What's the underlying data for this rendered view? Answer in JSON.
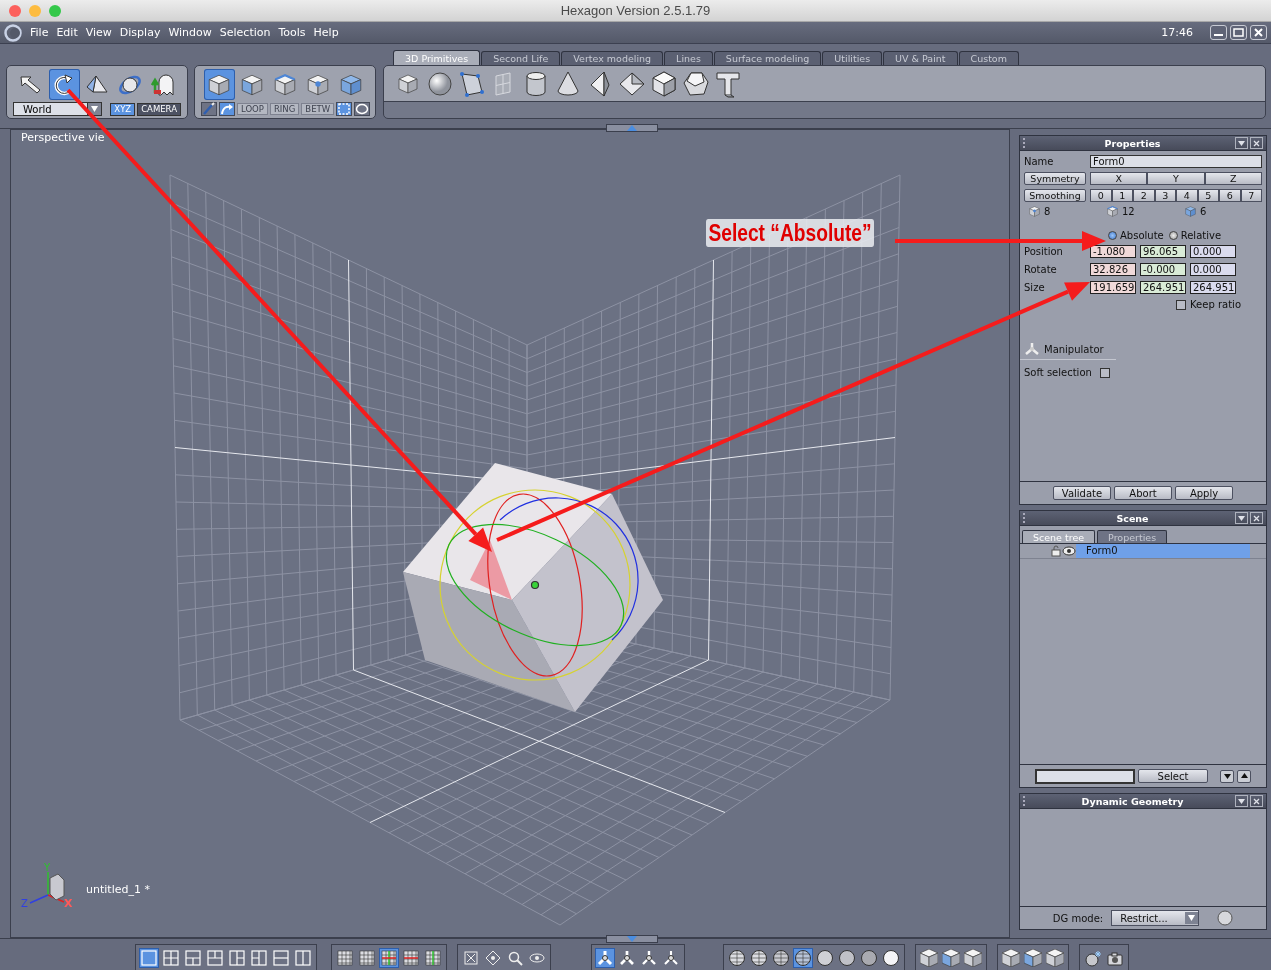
{
  "window": {
    "title": "Hexagon Version 2.5.1.79"
  },
  "menu": [
    "File",
    "Edit",
    "View",
    "Display",
    "Window",
    "Selection",
    "Tools",
    "Help"
  ],
  "clock": "17:46",
  "tool_group": {
    "tools": [
      {
        "kind": "pointer",
        "selected": false
      },
      {
        "kind": "rotate",
        "selected": true
      },
      {
        "kind": "cone",
        "selected": false
      },
      {
        "kind": "orbit",
        "selected": false
      },
      {
        "kind": "ghost",
        "selected": false
      }
    ],
    "space": "World",
    "modes": [
      {
        "label": "XYZ",
        "selected": true
      },
      {
        "label": "CAMERA",
        "selected": false
      }
    ]
  },
  "selection_group": {
    "modes": [
      {
        "kind": "object",
        "selected": true
      },
      {
        "kind": "face",
        "selected": false
      },
      {
        "kind": "edge",
        "selected": false
      },
      {
        "kind": "vertex",
        "selected": false
      },
      {
        "kind": "auto",
        "selected": false
      }
    ],
    "paint_modes": [
      {
        "kind": "brush",
        "selected": false
      },
      {
        "kind": "sweep",
        "selected": true
      }
    ],
    "loop_buttons": [
      {
        "label": "LOOP",
        "disabled": true
      },
      {
        "label": "RING",
        "disabled": true
      },
      {
        "label": "BETW",
        "disabled": true
      }
    ],
    "marquee_modes": [
      {
        "kind": "rectangle",
        "selected": true
      },
      {
        "kind": "lasso",
        "selected": false
      }
    ]
  },
  "tabs": [
    {
      "label": "3D Primitives",
      "selected": true
    },
    {
      "label": "Second Life",
      "selected": false
    },
    {
      "label": "Vertex modeling",
      "selected": false
    },
    {
      "label": "Lines",
      "selected": false
    },
    {
      "label": "Surface modeling",
      "selected": false
    },
    {
      "label": "Utilities",
      "selected": false
    },
    {
      "label": "UV & Paint",
      "selected": false
    },
    {
      "label": "Custom",
      "selected": false
    }
  ],
  "primitives": [
    {
      "kind": "cube"
    },
    {
      "kind": "sphere"
    },
    {
      "kind": "polygon"
    },
    {
      "kind": "plane"
    },
    {
      "kind": "cylinder"
    },
    {
      "kind": "cone"
    },
    {
      "kind": "pyramid"
    },
    {
      "kind": "diamond"
    },
    {
      "kind": "polyhedron"
    },
    {
      "kind": "dodecahedron"
    },
    {
      "kind": "text"
    }
  ],
  "viewport": {
    "label": "Perspective vie",
    "document": "untitled_1 *",
    "axes": [
      "Y",
      "Z",
      "X"
    ]
  },
  "annotation": {
    "text": "Select “Absolute”"
  },
  "properties": {
    "title": "Properties",
    "name_label": "Name",
    "name_value": "Form0",
    "symmetry": {
      "label": "Symmetry",
      "axes": [
        "X",
        "Y",
        "Z"
      ]
    },
    "smoothing": {
      "label": "Smoothing",
      "levels": [
        "0",
        "1",
        "2",
        "3",
        "4",
        "5",
        "6",
        "7"
      ]
    },
    "counts": [
      {
        "kind": "vertex",
        "value": "8"
      },
      {
        "kind": "edge",
        "value": "12"
      },
      {
        "kind": "face",
        "value": "6"
      }
    ],
    "coordinate_modes": [
      {
        "label": "Absolute",
        "selected": true
      },
      {
        "label": "Relative",
        "selected": false
      }
    ],
    "transforms": [
      {
        "label": "Position",
        "values": [
          "-1.080",
          "96.065",
          "0.000"
        ]
      },
      {
        "label": "Rotate",
        "values": [
          "32.826",
          "-0.000",
          "0.000"
        ]
      },
      {
        "label": "Size",
        "values": [
          "191.659",
          "264.951",
          "264.951"
        ]
      }
    ],
    "keep_ratio": {
      "label": "Keep ratio",
      "checked": false
    },
    "manipulator": "Manipulator",
    "soft_selection": {
      "label": "Soft selection",
      "checked": false
    },
    "buttons": [
      "Validate",
      "Abort",
      "Apply"
    ]
  },
  "scene": {
    "title": "Scene",
    "tabs": [
      {
        "label": "Scene tree",
        "selected": true
      },
      {
        "label": "Properties",
        "selected": false
      }
    ],
    "tree": [
      {
        "label": "Form0",
        "selected": true
      }
    ],
    "select_button": "Select"
  },
  "dynamic_geometry": {
    "title": "Dynamic Geometry",
    "mode_label": "DG mode:",
    "mode_value": "Restrict..."
  },
  "bottom_toolbar": [
    {
      "kind": "layout",
      "items": [
        {
          "selected": true
        },
        {
          "selected": false
        },
        {
          "selected": false
        },
        {
          "selected": false
        },
        {
          "selected": false
        },
        {
          "selected": false
        },
        {
          "selected": false
        },
        {
          "selected": false
        }
      ]
    },
    {
      "kind": "grid",
      "items": [
        {
          "selected": false
        },
        {
          "selected": false
        },
        {
          "selected": true
        },
        {
          "selected": false
        },
        {
          "selected": false
        }
      ]
    },
    {
      "kind": "navigation",
      "items": [
        {
          "selected": false
        },
        {
          "selected": false
        },
        {
          "selected": false
        },
        {
          "selected": false
        }
      ]
    },
    {
      "kind": "manipulator",
      "items": [
        {
          "selected": true
        },
        {
          "selected": false
        },
        {
          "selected": false
        },
        {
          "selected": false
        }
      ]
    },
    {
      "kind": "shading",
      "items": [
        {
          "selected": false
        },
        {
          "selected": false
        },
        {
          "selected": false
        },
        {
          "selected": true
        },
        {
          "selected": false
        },
        {
          "selected": false
        },
        {
          "selected": false
        },
        {
          "selected": false
        }
      ]
    },
    {
      "kind": "shape",
      "items": [
        {
          "selected": false
        },
        {
          "selected": false
        },
        {
          "selected": false
        }
      ]
    },
    {
      "kind": "shape",
      "items": [
        {
          "selected": false
        },
        {
          "selected": false
        },
        {
          "selected": false
        }
      ]
    },
    {
      "kind": "render",
      "items": [
        {
          "selected": false
        },
        {
          "selected": false
        }
      ]
    }
  ]
}
